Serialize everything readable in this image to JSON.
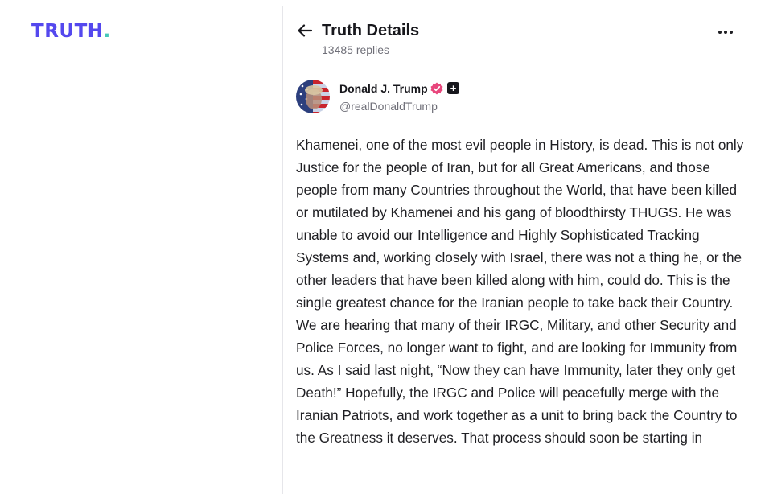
{
  "brand": {
    "logo_text": "TRUTH",
    "logo_dot": "."
  },
  "header": {
    "title": "Truth Details",
    "reply_count": "13485 replies"
  },
  "post": {
    "author_name": "Donald J. Trump",
    "author_handle": "@realDonaldTrump",
    "body": "Khamenei, one of the most evil people in History, is dead. This is not only Justice for the people of Iran, but for all Great Americans, and those people from many Countries throughout the World, that have been killed or mutilated by Khamenei and his gang of bloodthirsty THUGS. He was unable to avoid our Intelligence and Highly Sophisticated Tracking Systems and, working closely with Israel, there was not a thing he, or the other leaders that have been killed along with him, could do. This is the single greatest chance for the Iranian people to take back their Country. We are hearing that many of their IRGC, Military, and other Security and Police Forces, no longer want to fight, and are looking for Immunity from us. As I said last night, “Now they can have Immunity, later they only get Death!” Hopefully, the IRGC and Police will peacefully merge with the Iranian Patriots, and work together as a unit to bring back the Country to the Greatness it deserves. That process should soon be starting in"
  },
  "icons": {
    "back": "arrow-left-icon",
    "more": "more-horizontal-icon",
    "verified": "verified-badge-icon",
    "plus": "plus-badge-icon"
  },
  "colors": {
    "brand": "#5448ee",
    "brand_accent": "#47c8b8",
    "verified": "#e8467c",
    "muted_text": "#6f6f78",
    "divider": "#e6e6ea"
  }
}
